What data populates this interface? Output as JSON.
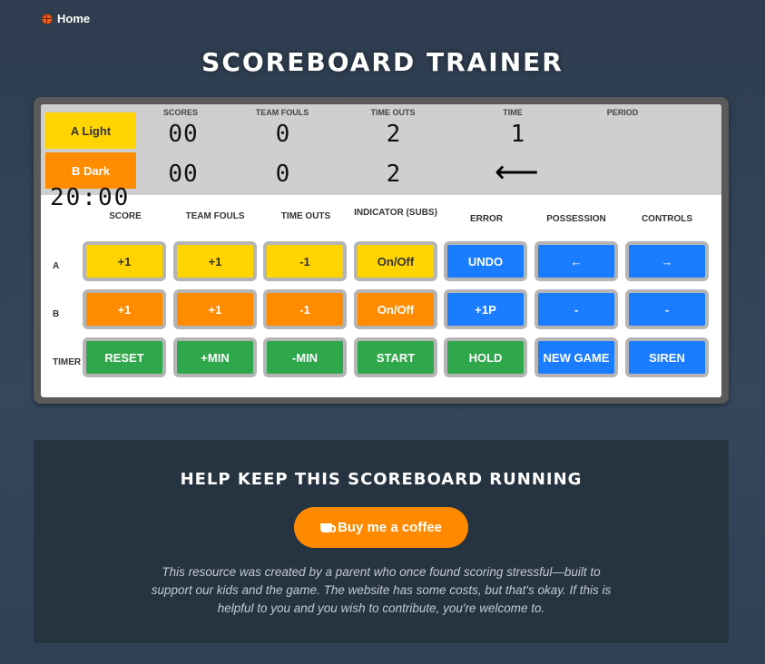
{
  "nav": {
    "home_label": "Home"
  },
  "page": {
    "title": "SCOREBOARD TRAINER"
  },
  "board": {
    "headers": {
      "scores": "SCORES",
      "team_fouls": "TEAM FOULS",
      "time_outs": "TIME OUTS",
      "time": "TIME",
      "period": "PERIOD"
    },
    "team_a": {
      "name": "A Light",
      "score": "00",
      "fouls": "0",
      "timeouts": "2",
      "time_digit": "1"
    },
    "team_b": {
      "name": "B Dark",
      "score": "00",
      "fouls": "0",
      "timeouts": "2"
    },
    "possession_arrow": "⟵",
    "clock": "20:00"
  },
  "controls": {
    "columns": {
      "score": "SCORE",
      "team_fouls": "TEAM FOULS",
      "time_outs": "TIME OUTS",
      "indicator": "INDICATOR (SUBS)",
      "error": "ERROR",
      "possession": "POSSESSION",
      "controls": "CONTROLS"
    },
    "row_labels": {
      "a": "A",
      "b": "B",
      "timer": "TIMER"
    },
    "row_a": {
      "score": "+1",
      "fouls": "+1",
      "timeouts": "-1",
      "indicator": "On/Off",
      "error": "UNDO",
      "possession": "←",
      "controls": "→"
    },
    "row_b": {
      "score": "+1",
      "fouls": "+1",
      "timeouts": "-1",
      "indicator": "On/Off",
      "error": "+1P",
      "possession": "-",
      "controls": "-"
    },
    "row_timer": {
      "reset": "RESET",
      "plus_min": "+MIN",
      "minus_min": "-MIN",
      "start": "START",
      "hold": "HOLD",
      "new_game": "NEW GAME",
      "siren": "SIREN"
    }
  },
  "support": {
    "title": "HELP KEEP THIS SCOREBOARD RUNNING",
    "button_label": "Buy me a coffee",
    "text": "This resource was created by a parent who once found scoring stressful—built to support our kids and the game. The website has some costs, but that's okay. If this is helpful to you and you wish to contribute, you're welcome to."
  },
  "colors": {
    "yellow": "#ffd400",
    "orange": "#ff8c00",
    "blue": "#1a7cff",
    "green": "#2ea84a"
  }
}
